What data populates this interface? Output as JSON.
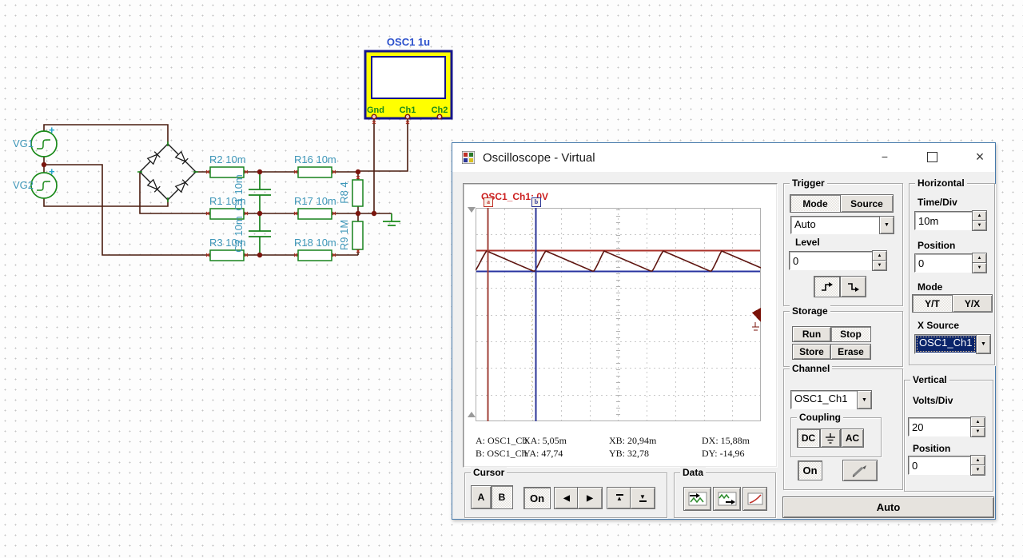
{
  "icons": {
    "up_arrow": "▲",
    "down_arrow": "▼",
    "left_arrow": "◀",
    "right_arrow": "▶",
    "combo_arrow": "▼",
    "minimize": "−",
    "close": "×",
    "plus": "+"
  },
  "colors": {
    "wire": "#4a1c0e",
    "component_green": "#1a8a1a",
    "circuit_label": "#3d96b8",
    "osc_body_yellow": "#ffff00",
    "osc_border_navy": "#15158c",
    "trace_maroon": "#5e1510",
    "level_line_red": "#aa3028",
    "level_line_blue": "#2733a0",
    "cursor_a_red": "#a04038",
    "cursor_b_blue": "#2b3596",
    "selection_navy": "#0a246a",
    "window_border_blue": "#4579ab",
    "trace_label_red": "#cc2020"
  },
  "circuit": {
    "labels": {
      "vg1": "VG1",
      "vg2": "VG2",
      "r2": "R2 10m",
      "r16": "R16 10m",
      "r1": "R1 10m",
      "r17": "R17 10m",
      "r3": "R3 10m",
      "r18": "R18 10m",
      "r8": "R8 4",
      "r9": "R9 1M",
      "c1": "C1 10m",
      "c2": "C2 10m"
    },
    "oscilloscope_block": {
      "title": "OSC1 1u",
      "pin_gnd": "Gnd",
      "pin_ch1": "Ch1",
      "pin_ch2": "Ch2"
    }
  },
  "window": {
    "title": "Oscilloscope - Virtual"
  },
  "scope_display": {
    "trace_label": "OSC1_Ch1: 0V",
    "cursor_a_handle": "a",
    "cursor_b_handle": "b",
    "readout": {
      "row_a": [
        "A: OSC1_Ch",
        "XA: 5,05m",
        "XB: 20,94m",
        "DX: 15,88m"
      ],
      "row_b": [
        "B: OSC1_Ch",
        "YA: 47,74",
        "YB: 32,78",
        "DY: -14,96"
      ]
    }
  },
  "trigger": {
    "title": "Trigger",
    "mode_btn": "Mode",
    "source_btn": "Source",
    "mode_value": "Auto",
    "level_label": "Level",
    "level_value": "0"
  },
  "horizontal": {
    "title": "Horizontal",
    "time_div_label": "Time/Div",
    "time_div_value": "10m",
    "position_label": "Position",
    "position_value": "0",
    "mode_label": "Mode",
    "yt_btn": "Y/T",
    "yx_btn": "Y/X",
    "x_source_label": "X Source",
    "x_source_value": "OSC1_Ch1"
  },
  "storage": {
    "title": "Storage",
    "run_btn": "Run",
    "stop_btn": "Stop",
    "store_btn": "Store",
    "erase_btn": "Erase"
  },
  "channel": {
    "title": "Channel",
    "value": "OSC1_Ch1",
    "coupling_title": "Coupling",
    "dc_btn": "DC",
    "ac_btn": "AC",
    "on_btn": "On"
  },
  "vertical": {
    "title": "Vertical",
    "volts_div_label": "Volts/Div",
    "volts_div_value": "20",
    "position_label": "Position",
    "position_value": "0"
  },
  "cursor_panel": {
    "title": "Cursor",
    "a_btn": "A",
    "b_btn": "B",
    "on_btn": "On"
  },
  "data_panel": {
    "title": "Data"
  },
  "auto_btn": "Auto"
}
